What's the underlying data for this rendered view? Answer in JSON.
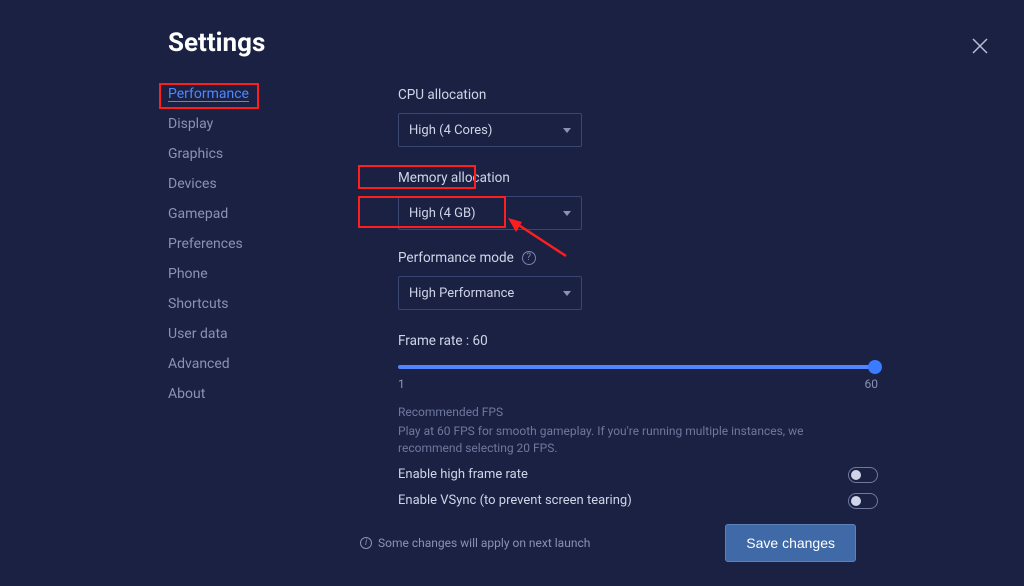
{
  "title": "Settings",
  "sidebar": {
    "items": [
      {
        "label": "Performance",
        "active": true
      },
      {
        "label": "Display"
      },
      {
        "label": "Graphics"
      },
      {
        "label": "Devices"
      },
      {
        "label": "Gamepad"
      },
      {
        "label": "Preferences"
      },
      {
        "label": "Phone"
      },
      {
        "label": "Shortcuts"
      },
      {
        "label": "User data"
      },
      {
        "label": "Advanced"
      },
      {
        "label": "About"
      }
    ]
  },
  "cpu": {
    "label": "CPU allocation",
    "value": "High (4 Cores)"
  },
  "memory": {
    "label": "Memory allocation",
    "value": "High (4 GB)"
  },
  "mode": {
    "label": "Performance mode",
    "value": "High Performance"
  },
  "frame": {
    "label": "Frame rate : 60",
    "min": "1",
    "max": "60",
    "rec_title": "Recommended FPS",
    "rec_body": "Play at 60 FPS for smooth gameplay. If you're running multiple instances, we recommend selecting 20 FPS."
  },
  "toggles": {
    "high_frame": "Enable high frame rate",
    "vsync": "Enable VSync (to prevent screen tearing)"
  },
  "footer": {
    "info": "Some changes will apply on next launch",
    "save": "Save changes"
  }
}
